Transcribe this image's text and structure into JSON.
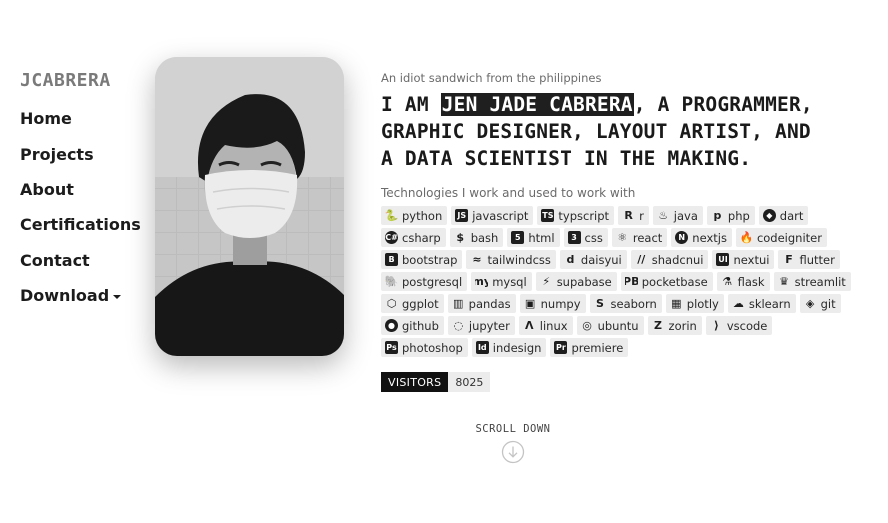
{
  "brand": "JCABRERA",
  "nav": [
    {
      "label": "Home"
    },
    {
      "label": "Projects"
    },
    {
      "label": "About"
    },
    {
      "label": "Certifications"
    },
    {
      "label": "Contact"
    },
    {
      "label": "Download"
    }
  ],
  "hero": {
    "tagline": "An idiot sandwich from the philippines",
    "headline_prefix": "I AM ",
    "headline_name": "JEN JADE CABRERA",
    "headline_line1_rest": ", A PROGRAMMER,",
    "headline_line2": "GRAPHIC DESIGNER, LAYOUT ARTIST, AND",
    "headline_line3": "A DATA SCIENTIST IN THE MAKING."
  },
  "tech": {
    "title": "Technologies I work and used to work with",
    "items": [
      {
        "label": "python",
        "icon": "python-icon",
        "glyph": "🐍"
      },
      {
        "label": "javascript",
        "icon": "javascript-icon",
        "glyph": "JS"
      },
      {
        "label": "typscript",
        "icon": "typescript-icon",
        "glyph": "TS"
      },
      {
        "label": "r",
        "icon": "r-icon",
        "glyph": "R"
      },
      {
        "label": "java",
        "icon": "java-icon",
        "glyph": "♨"
      },
      {
        "label": "php",
        "icon": "php-icon",
        "glyph": "p"
      },
      {
        "label": "dart",
        "icon": "dart-icon",
        "glyph": "◆"
      },
      {
        "label": "csharp",
        "icon": "csharp-icon",
        "glyph": "C#"
      },
      {
        "label": "bash",
        "icon": "bash-icon",
        "glyph": "$"
      },
      {
        "label": "html",
        "icon": "html-icon",
        "glyph": "5"
      },
      {
        "label": "css",
        "icon": "css-icon",
        "glyph": "3"
      },
      {
        "label": "react",
        "icon": "react-icon",
        "glyph": "⚛"
      },
      {
        "label": "nextjs",
        "icon": "nextjs-icon",
        "glyph": "N"
      },
      {
        "label": "codeigniter",
        "icon": "codeigniter-icon",
        "glyph": "🔥"
      },
      {
        "label": "bootstrap",
        "icon": "bootstrap-icon",
        "glyph": "B"
      },
      {
        "label": "tailwindcss",
        "icon": "tailwind-icon",
        "glyph": "≈"
      },
      {
        "label": "daisyui",
        "icon": "daisyui-icon",
        "glyph": "d"
      },
      {
        "label": "shadcnui",
        "icon": "shadcn-icon",
        "glyph": "//"
      },
      {
        "label": "nextui",
        "icon": "nextui-icon",
        "glyph": "UI"
      },
      {
        "label": "flutter",
        "icon": "flutter-icon",
        "glyph": "F"
      },
      {
        "label": "postgresql",
        "icon": "postgresql-icon",
        "glyph": "🐘"
      },
      {
        "label": "mysql",
        "icon": "mysql-icon",
        "glyph": "my"
      },
      {
        "label": "supabase",
        "icon": "supabase-icon",
        "glyph": "⚡"
      },
      {
        "label": "pocketbase",
        "icon": "pocketbase-icon",
        "glyph": "PB"
      },
      {
        "label": "flask",
        "icon": "flask-icon",
        "glyph": "⚗"
      },
      {
        "label": "streamlit",
        "icon": "streamlit-icon",
        "glyph": "♛"
      },
      {
        "label": "ggplot",
        "icon": "ggplot-icon",
        "glyph": "⬡"
      },
      {
        "label": "pandas",
        "icon": "pandas-icon",
        "glyph": "▥"
      },
      {
        "label": "numpy",
        "icon": "numpy-icon",
        "glyph": "▣"
      },
      {
        "label": "seaborn",
        "icon": "seaborn-icon",
        "glyph": "S"
      },
      {
        "label": "plotly",
        "icon": "plotly-icon",
        "glyph": "▦"
      },
      {
        "label": "sklearn",
        "icon": "sklearn-icon",
        "glyph": "☁"
      },
      {
        "label": "git",
        "icon": "git-icon",
        "glyph": "◈"
      },
      {
        "label": "github",
        "icon": "github-icon",
        "glyph": "●"
      },
      {
        "label": "jupyter",
        "icon": "jupyter-icon",
        "glyph": "◌"
      },
      {
        "label": "linux",
        "icon": "linux-icon",
        "glyph": "Λ"
      },
      {
        "label": "ubuntu",
        "icon": "ubuntu-icon",
        "glyph": "◎"
      },
      {
        "label": "zorin",
        "icon": "zorin-icon",
        "glyph": "Z"
      },
      {
        "label": "vscode",
        "icon": "vscode-icon",
        "glyph": "⟩"
      },
      {
        "label": "photoshop",
        "icon": "photoshop-icon",
        "glyph": "Ps"
      },
      {
        "label": "indesign",
        "icon": "indesign-icon",
        "glyph": "Id"
      },
      {
        "label": "premiere",
        "icon": "premiere-icon",
        "glyph": "Pr"
      }
    ]
  },
  "visitors": {
    "label": "VISITORS",
    "count": "8025"
  },
  "scroll": {
    "label": "SCROLL DOWN"
  }
}
